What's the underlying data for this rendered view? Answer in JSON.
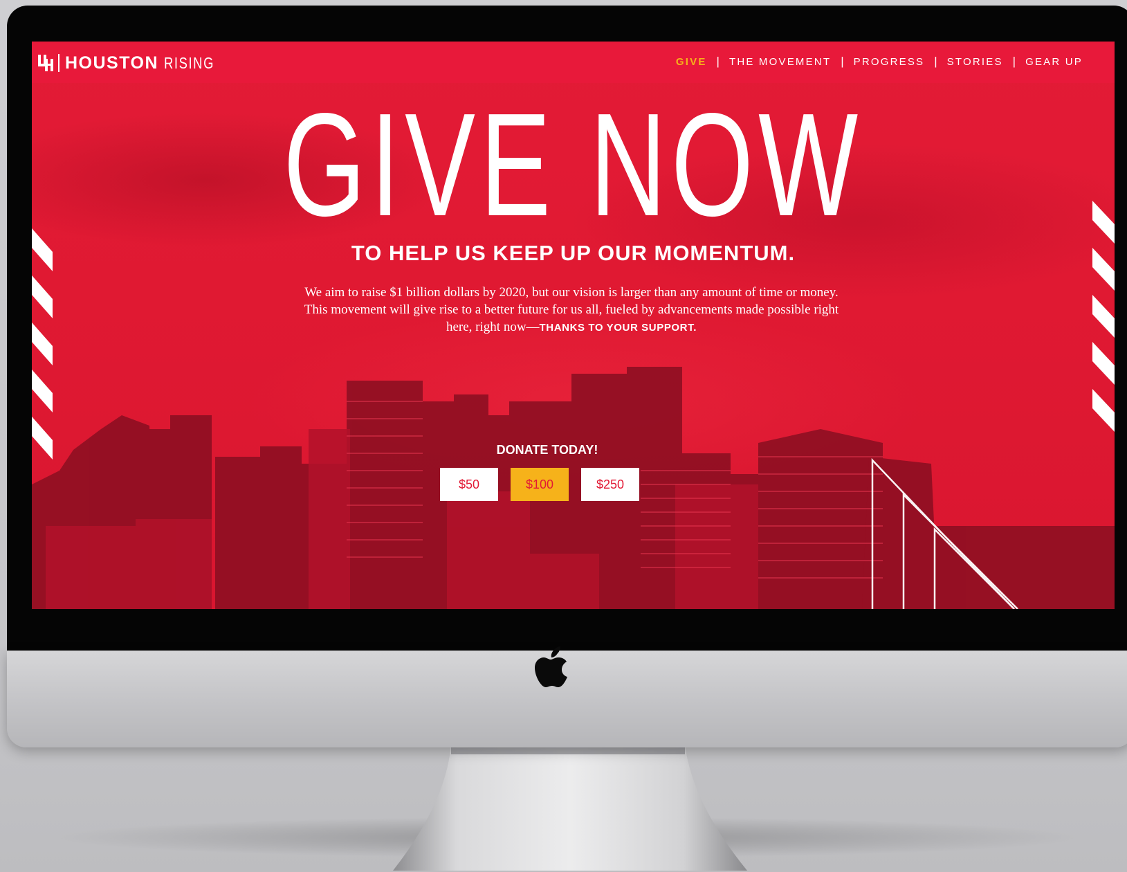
{
  "brand": {
    "name_bold": "HOUSTON",
    "name_light": "RISING",
    "mark_text": "UH"
  },
  "nav": {
    "items": [
      {
        "label": "GIVE",
        "active": true
      },
      {
        "label": "THE MOVEMENT",
        "active": false
      },
      {
        "label": "PROGRESS",
        "active": false
      },
      {
        "label": "STORIES",
        "active": false
      },
      {
        "label": "GEAR UP",
        "active": false
      }
    ],
    "separator": "|"
  },
  "hero": {
    "headline": "GIVE NOW",
    "subhead": "TO HELP US KEEP UP OUR MOMENTUM.",
    "body_line1": "We aim to raise $1 billion dollars by 2020, but our vision is larger than any amount of time or money.",
    "body_line2": "This movement will give rise to a better future for us all, fueled by advancements made possible right",
    "body_line3_prefix": "here, right now—",
    "body_line3_emphasis": "THANKS TO YOUR SUPPORT."
  },
  "donate": {
    "label": "DONATE TODAY!",
    "amounts": [
      {
        "label": "$50",
        "selected": false
      },
      {
        "label": "$100",
        "selected": true
      },
      {
        "label": "$250",
        "selected": false
      }
    ]
  },
  "colors": {
    "brand_red": "#e21a35",
    "accent_gold": "#f6b21a",
    "white": "#ffffff"
  },
  "icons": {
    "logo": "uh-logo-icon",
    "device_logo": "apple-icon"
  }
}
